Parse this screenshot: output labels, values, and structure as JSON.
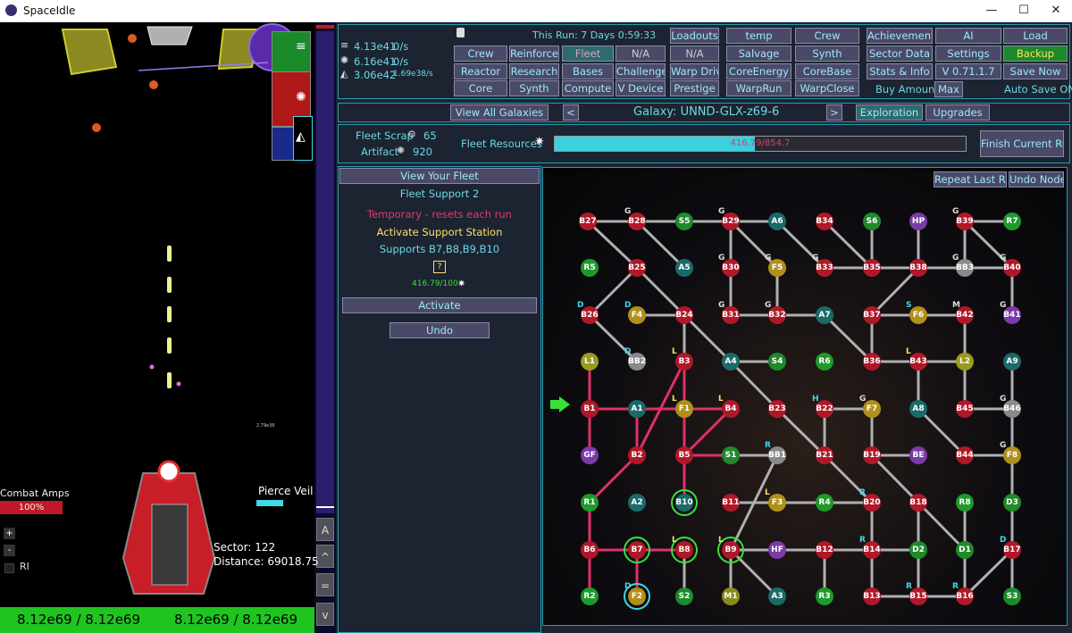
{
  "window": {
    "title": "SpaceIdle",
    "minimize": "—",
    "maximize": "☐",
    "close": "✕"
  },
  "game": {
    "combat_amps_label": "Combat Amps",
    "combat_amps_value": "100%",
    "pierce_veil_label": "Pierce Veil",
    "sector_label": "Sector: 122",
    "distance_label": "Distance: 69018.75",
    "plus": "+",
    "minus": "-",
    "ri_label": "RI",
    "small_value": "2.79e36",
    "left_side_buttons": [
      "A",
      "^",
      "=",
      "v"
    ],
    "bottom_left": "8.12e69 / 8.12e69",
    "bottom_right": "8.12e69 / 8.12e69"
  },
  "resources": [
    {
      "icon": "database-icon",
      "value": "4.13e41",
      "rate": "0/s"
    },
    {
      "icon": "gear-cluster-icon",
      "value": "6.16e41",
      "rate": "0/s"
    },
    {
      "icon": "triangle-shard-icon",
      "value": "3.06e42",
      "rate": "1.69e38/s"
    }
  ],
  "run_info": "This Run: 7 Days 0:59:33",
  "nav": {
    "col1": [
      "Crew",
      "Reactor",
      "Core"
    ],
    "col2": [
      "Reinforce",
      "Research",
      "Synth"
    ],
    "col3": [
      "Fleet",
      "Bases",
      "Compute"
    ],
    "col4": [
      "N/A",
      "Challenges",
      "V Device"
    ],
    "col5": [
      "Loadouts",
      "N/A",
      "Warp Drive",
      "Prestige"
    ],
    "col6": [
      "temp",
      "Salvage",
      "CoreEnergy",
      "WarpRun"
    ],
    "col7": [
      "Crew",
      "Synth",
      "CoreBase",
      "WarpClose"
    ],
    "col8": [
      "Achievements",
      "Sector Data",
      "Stats & Info"
    ],
    "col9": [
      "AI",
      "Settings",
      "V 0.71.1.7"
    ],
    "col10": [
      "Load",
      "Backup",
      "Save Now"
    ],
    "amount_label": "Buy Amount:",
    "amount_value": "Max",
    "auto_save": "Auto Save ON"
  },
  "galaxy": {
    "view_all": "View All Galaxies",
    "prev": "<",
    "next": ">",
    "name": "Galaxy: UNND-GLX-z69-6",
    "tab_exploration": "Exploration",
    "tab_upgrades": "Upgrades",
    "fleet_scrap_label": "Fleet Scrap",
    "fleet_scrap_value": "65",
    "artifact_label": "Artifact",
    "artifact_value": "920",
    "fleet_resources_label": "Fleet Resources",
    "fleet_resources_text": "416.79/854.7",
    "fleet_resources_fraction": 0.4876,
    "finish_run": "Finish Current Run"
  },
  "fleet_panel": {
    "view_fleet": "View Your Fleet",
    "title": "Fleet Support 2",
    "temporary": "Temporary - resets each run",
    "activate_title": "Activate Support Station",
    "supports": "Supports B7,B8,B9,B10",
    "question": "?",
    "cost": "416.79/100",
    "activate": "Activate",
    "undo": "Undo"
  },
  "map": {
    "repeat_last": "Repeat Last Run",
    "undo_nodes": "Undo Nodes",
    "colors": {
      "B": "#b01828",
      "A": "#1a6a6a",
      "S": "#1f8a2a",
      "G": "#888a8a",
      "F": "#b0901a",
      "M": "#8a8a1a",
      "P": "#7a3aa8",
      "R": "#1e9a2a",
      "L": "#9a9a1e"
    },
    "nodes": [
      [
        "B27",
        "B",
        658,
        248,
        ""
      ],
      [
        "B28",
        "B",
        713,
        248,
        "G"
      ],
      [
        "S5",
        "S",
        766,
        248,
        ""
      ],
      [
        "B29",
        "B",
        818,
        248,
        "G"
      ],
      [
        "A6",
        "A",
        870,
        248,
        ""
      ],
      [
        "B34",
        "B",
        923,
        248,
        ""
      ],
      [
        "S6",
        "S",
        976,
        248,
        ""
      ],
      [
        "HP",
        "P",
        1028,
        248,
        ""
      ],
      [
        "B39",
        "B",
        1080,
        248,
        "G"
      ],
      [
        "R7",
        "R",
        1133,
        248,
        ""
      ],
      [
        "R5",
        "R",
        660,
        300,
        ""
      ],
      [
        "B25",
        "B",
        713,
        300,
        ""
      ],
      [
        "A5",
        "A",
        766,
        300,
        ""
      ],
      [
        "B30",
        "B",
        818,
        300,
        "G"
      ],
      [
        "F5",
        "F",
        870,
        300,
        "G"
      ],
      [
        "B33",
        "B",
        923,
        300,
        "G"
      ],
      [
        "B35",
        "B",
        976,
        300,
        ""
      ],
      [
        "B38",
        "B",
        1028,
        300,
        ""
      ],
      [
        "BB3",
        "G",
        1080,
        300,
        "G"
      ],
      [
        "B40",
        "B",
        1133,
        300,
        "G"
      ],
      [
        "B26",
        "B",
        660,
        353,
        "D"
      ],
      [
        "F4",
        "F",
        713,
        353,
        "D"
      ],
      [
        "B24",
        "B",
        766,
        353,
        ""
      ],
      [
        "B31",
        "B",
        818,
        353,
        "G"
      ],
      [
        "B32",
        "B",
        870,
        353,
        "G"
      ],
      [
        "A7",
        "A",
        923,
        353,
        ""
      ],
      [
        "B37",
        "B",
        976,
        353,
        ""
      ],
      [
        "F6",
        "F",
        1028,
        353,
        "S"
      ],
      [
        "B42",
        "B",
        1080,
        353,
        "M"
      ],
      [
        "B41",
        "P",
        1133,
        353,
        "G"
      ],
      [
        "L1",
        "L",
        660,
        405,
        ""
      ],
      [
        "BB2",
        "G",
        713,
        405,
        "D"
      ],
      [
        "B3",
        "B",
        766,
        405,
        "L"
      ],
      [
        "A4",
        "A",
        818,
        405,
        ""
      ],
      [
        "S4",
        "S",
        870,
        405,
        ""
      ],
      [
        "R6",
        "R",
        923,
        405,
        ""
      ],
      [
        "B36",
        "B",
        976,
        405,
        ""
      ],
      [
        "B43",
        "B",
        1028,
        405,
        "L"
      ],
      [
        "L2",
        "L",
        1080,
        405,
        ""
      ],
      [
        "A9",
        "A",
        1133,
        405,
        ""
      ],
      [
        "B1",
        "B",
        660,
        458,
        ""
      ],
      [
        "A1",
        "A",
        713,
        458,
        ""
      ],
      [
        "F1",
        "F",
        766,
        458,
        "L"
      ],
      [
        "B4",
        "B",
        818,
        458,
        "L"
      ],
      [
        "B23",
        "B",
        870,
        458,
        ""
      ],
      [
        "B22",
        "B",
        923,
        458,
        "H"
      ],
      [
        "F7",
        "F",
        976,
        458,
        "G"
      ],
      [
        "A8",
        "A",
        1028,
        458,
        ""
      ],
      [
        "B45",
        "B",
        1080,
        458,
        ""
      ],
      [
        "B46",
        "G",
        1133,
        458,
        "G"
      ],
      [
        "GF",
        "P",
        660,
        510,
        ""
      ],
      [
        "B2",
        "B",
        713,
        510,
        ""
      ],
      [
        "B5",
        "B",
        766,
        510,
        ""
      ],
      [
        "S1",
        "S",
        818,
        510,
        ""
      ],
      [
        "BB1",
        "G",
        870,
        510,
        "R"
      ],
      [
        "B21",
        "B",
        923,
        510,
        ""
      ],
      [
        "B19",
        "B",
        976,
        510,
        ""
      ],
      [
        "BE",
        "P",
        1028,
        510,
        ""
      ],
      [
        "B44",
        "B",
        1080,
        510,
        ""
      ],
      [
        "F8",
        "F",
        1133,
        510,
        "G"
      ],
      [
        "R1",
        "R",
        660,
        563,
        ""
      ],
      [
        "A2",
        "A",
        713,
        563,
        ""
      ],
      [
        "B10",
        "A",
        766,
        563,
        ""
      ],
      [
        "B11",
        "B",
        818,
        563,
        ""
      ],
      [
        "F3",
        "F",
        870,
        563,
        "L"
      ],
      [
        "R4",
        "R",
        923,
        563,
        ""
      ],
      [
        "B20",
        "B",
        976,
        563,
        "R"
      ],
      [
        "B18",
        "B",
        1028,
        563,
        ""
      ],
      [
        "R8",
        "R",
        1080,
        563,
        ""
      ],
      [
        "D3",
        "S",
        1133,
        563,
        ""
      ],
      [
        "B6",
        "B",
        660,
        616,
        ""
      ],
      [
        "B7",
        "B",
        713,
        616,
        ""
      ],
      [
        "B8",
        "B",
        766,
        616,
        "L"
      ],
      [
        "B9",
        "B",
        818,
        616,
        "L"
      ],
      [
        "HF",
        "P",
        870,
        616,
        ""
      ],
      [
        "B12",
        "B",
        923,
        616,
        ""
      ],
      [
        "B14",
        "B",
        976,
        616,
        "R"
      ],
      [
        "D2",
        "S",
        1028,
        616,
        ""
      ],
      [
        "D1",
        "S",
        1080,
        616,
        ""
      ],
      [
        "B17",
        "B",
        1133,
        616,
        "D"
      ],
      [
        "R2",
        "R",
        660,
        668,
        ""
      ],
      [
        "F2",
        "F",
        713,
        668,
        "D"
      ],
      [
        "S2",
        "S",
        766,
        668,
        ""
      ],
      [
        "M1",
        "M",
        818,
        668,
        ""
      ],
      [
        "A3",
        "A",
        870,
        668,
        ""
      ],
      [
        "R3",
        "R",
        923,
        668,
        ""
      ],
      [
        "B13",
        "B",
        976,
        668,
        ""
      ],
      [
        "B15",
        "B",
        1028,
        668,
        "R"
      ],
      [
        "B16",
        "B",
        1080,
        668,
        "R"
      ],
      [
        "S3",
        "S",
        1133,
        668,
        ""
      ]
    ],
    "edges_red": [
      [
        "B1",
        "A1"
      ],
      [
        "A1",
        "F1"
      ],
      [
        "F1",
        "B4"
      ],
      [
        "B1",
        "L1"
      ],
      [
        "B1",
        "GF"
      ],
      [
        "A1",
        "B2"
      ],
      [
        "B2",
        "B3"
      ],
      [
        "B3",
        "B5"
      ],
      [
        "B5",
        "B4"
      ],
      [
        "B2",
        "R1"
      ],
      [
        "R1",
        "B6"
      ],
      [
        "B6",
        "B7"
      ],
      [
        "B7",
        "F2"
      ],
      [
        "B6",
        "R2"
      ],
      [
        "B5",
        "S1"
      ],
      [
        "B5",
        "B10"
      ],
      [
        "B3",
        "F1"
      ],
      [
        "B6",
        "B8"
      ]
    ],
    "edges_gray": [
      [
        "B27",
        "B28"
      ],
      [
        "B28",
        "B29"
      ],
      [
        "B29",
        "A6"
      ],
      [
        "B34",
        "B35"
      ],
      [
        "S6",
        "B35"
      ],
      [
        "HP",
        "B38"
      ],
      [
        "B39",
        "R7"
      ],
      [
        "B39",
        "B40"
      ],
      [
        "B39",
        "BB3"
      ],
      [
        "B27",
        "B25"
      ],
      [
        "B28",
        "A5"
      ],
      [
        "B29",
        "B30"
      ],
      [
        "B29",
        "F5"
      ],
      [
        "A6",
        "B33"
      ],
      [
        "B33",
        "B35"
      ],
      [
        "B35",
        "B38"
      ],
      [
        "B38",
        "B40"
      ],
      [
        "B40",
        "B41"
      ],
      [
        "B25",
        "B26"
      ],
      [
        "B25",
        "B24"
      ],
      [
        "B24",
        "F4"
      ],
      [
        "B30",
        "B31"
      ],
      [
        "B31",
        "B32"
      ],
      [
        "F5",
        "B32"
      ],
      [
        "B32",
        "A7"
      ],
      [
        "A7",
        "B36"
      ],
      [
        "B37",
        "B36"
      ],
      [
        "B37",
        "F6"
      ],
      [
        "F6",
        "B42"
      ],
      [
        "B42",
        "L2"
      ],
      [
        "B24",
        "B3"
      ],
      [
        "B26",
        "BB2"
      ],
      [
        "B24",
        "A4"
      ],
      [
        "A4",
        "S4"
      ],
      [
        "A4",
        "B23"
      ],
      [
        "B23",
        "B21"
      ],
      [
        "B36",
        "B43"
      ],
      [
        "B43",
        "L2"
      ],
      [
        "B43",
        "A8"
      ],
      [
        "A8",
        "B44"
      ],
      [
        "L2",
        "B45"
      ],
      [
        "B45",
        "B46"
      ],
      [
        "B22",
        "F7"
      ],
      [
        "B22",
        "B21"
      ],
      [
        "F7",
        "B19"
      ],
      [
        "B19",
        "BE"
      ],
      [
        "B19",
        "B18"
      ],
      [
        "B20",
        "B21"
      ],
      [
        "B20",
        "R4"
      ],
      [
        "B20",
        "B14"
      ],
      [
        "B18",
        "B15"
      ],
      [
        "F3",
        "B11"
      ],
      [
        "F3",
        "R4"
      ],
      [
        "BB1",
        "S1"
      ],
      [
        "BB1",
        "B9"
      ],
      [
        "B9",
        "A3"
      ],
      [
        "B9",
        "B12"
      ],
      [
        "B12",
        "HF"
      ],
      [
        "B12",
        "B14"
      ],
      [
        "B12",
        "R3"
      ],
      [
        "B14",
        "B13"
      ],
      [
        "B14",
        "D2"
      ],
      [
        "B13",
        "B15"
      ],
      [
        "B15",
        "B16"
      ],
      [
        "D1",
        "B16"
      ],
      [
        "D1",
        "R8"
      ],
      [
        "B16",
        "B17"
      ],
      [
        "B17",
        "S3"
      ],
      [
        "D3",
        "B17"
      ],
      [
        "F8",
        "D3"
      ],
      [
        "B46",
        "F8"
      ],
      [
        "B44",
        "F8"
      ],
      [
        "A9",
        "B46"
      ],
      [
        "B8",
        "S2"
      ],
      [
        "B9",
        "M1"
      ],
      [
        "B18",
        "D1"
      ],
      [
        "B38",
        "B37"
      ]
    ]
  }
}
